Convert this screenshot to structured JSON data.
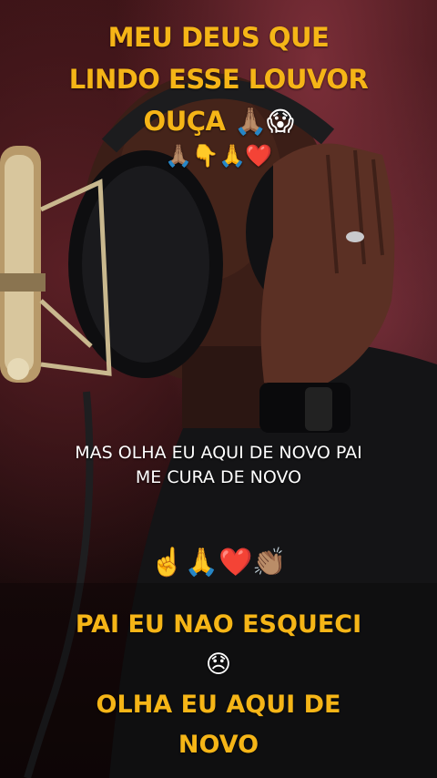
{
  "top_caption": {
    "line1": "MEU DEUS QUE",
    "line2": "LINDO ESSE LOUVOR",
    "line3": "OUÇA",
    "line3_emojis": "🙏🏽😱",
    "line4_emojis": "🙏🏽👇🙏❤️"
  },
  "lyric_caption": {
    "line1": "MAS OLHA EU AQUI DE NOVO PAI",
    "line2": "ME CURA DE NOVO"
  },
  "emoji_row": "☝️🙏❤️👏🏽",
  "bottom_caption": {
    "line1": "PAI EU NAO ESQUECI",
    "line2_emoji": "😞",
    "line3": "OLHA EU AQUI DE",
    "line4": "NOVO"
  },
  "colors": {
    "caption_yellow": "#f5b517",
    "caption_white": "#ffffff",
    "background_red": "#3a1316"
  }
}
